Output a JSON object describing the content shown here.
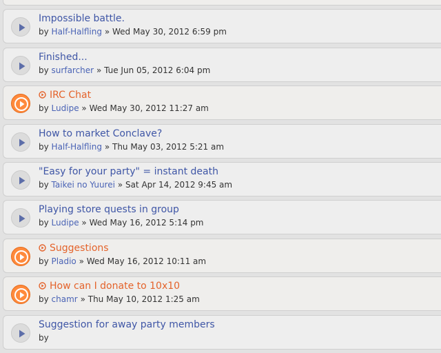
{
  "topics": [
    {
      "title": "",
      "by": "by",
      "author": "",
      "sep": "»",
      "date": "",
      "hot": true
    },
    {
      "title": "Impossible battle.",
      "by": "by",
      "author": "Half-Halfling",
      "sep": "»",
      "date": "Wed May 30, 2012 6:59 pm",
      "hot": false
    },
    {
      "title": "Finished...",
      "by": "by",
      "author": "surfarcher",
      "sep": "»",
      "date": "Tue Jun 05, 2012 6:04 pm",
      "hot": false
    },
    {
      "title": "IRC Chat",
      "by": "by",
      "author": "Ludipe",
      "sep": "»",
      "date": "Wed May 30, 2012 11:27 am",
      "hot": true
    },
    {
      "title": "How to market Conclave?",
      "by": "by",
      "author": "Half-Halfling",
      "sep": "»",
      "date": "Thu May 03, 2012 5:21 am",
      "hot": false
    },
    {
      "title": "\"Easy for your party\" = instant death",
      "by": "by",
      "author": "Taikei no Yuurei",
      "sep": "»",
      "date": "Sat Apr 14, 2012 9:45 am",
      "hot": false
    },
    {
      "title": "Playing store quests in group",
      "by": "by",
      "author": "Ludipe",
      "sep": "»",
      "date": "Wed May 16, 2012 5:14 pm",
      "hot": false
    },
    {
      "title": "Suggestions",
      "by": "by",
      "author": "Pladio",
      "sep": "»",
      "date": "Wed May 16, 2012 10:11 am",
      "hot": true
    },
    {
      "title": "How can I donate to 10x10",
      "by": "by",
      "author": "chamr",
      "sep": "»",
      "date": "Thu May 10, 2012 1:25 am",
      "hot": true
    },
    {
      "title": "Suggestion for away party members",
      "by": "by",
      "author": "",
      "sep": "",
      "date": "",
      "hot": false
    }
  ],
  "colors": {
    "link": "#3f56a6",
    "hot_title": "#e4632b",
    "hot_icon": "#ff8a3c",
    "read_icon": "#dcdcdc"
  },
  "icons": {
    "read_topic": "play-icon",
    "hot_topic": "play-icon-orange",
    "hot_marker": "circle-arrow-icon"
  }
}
